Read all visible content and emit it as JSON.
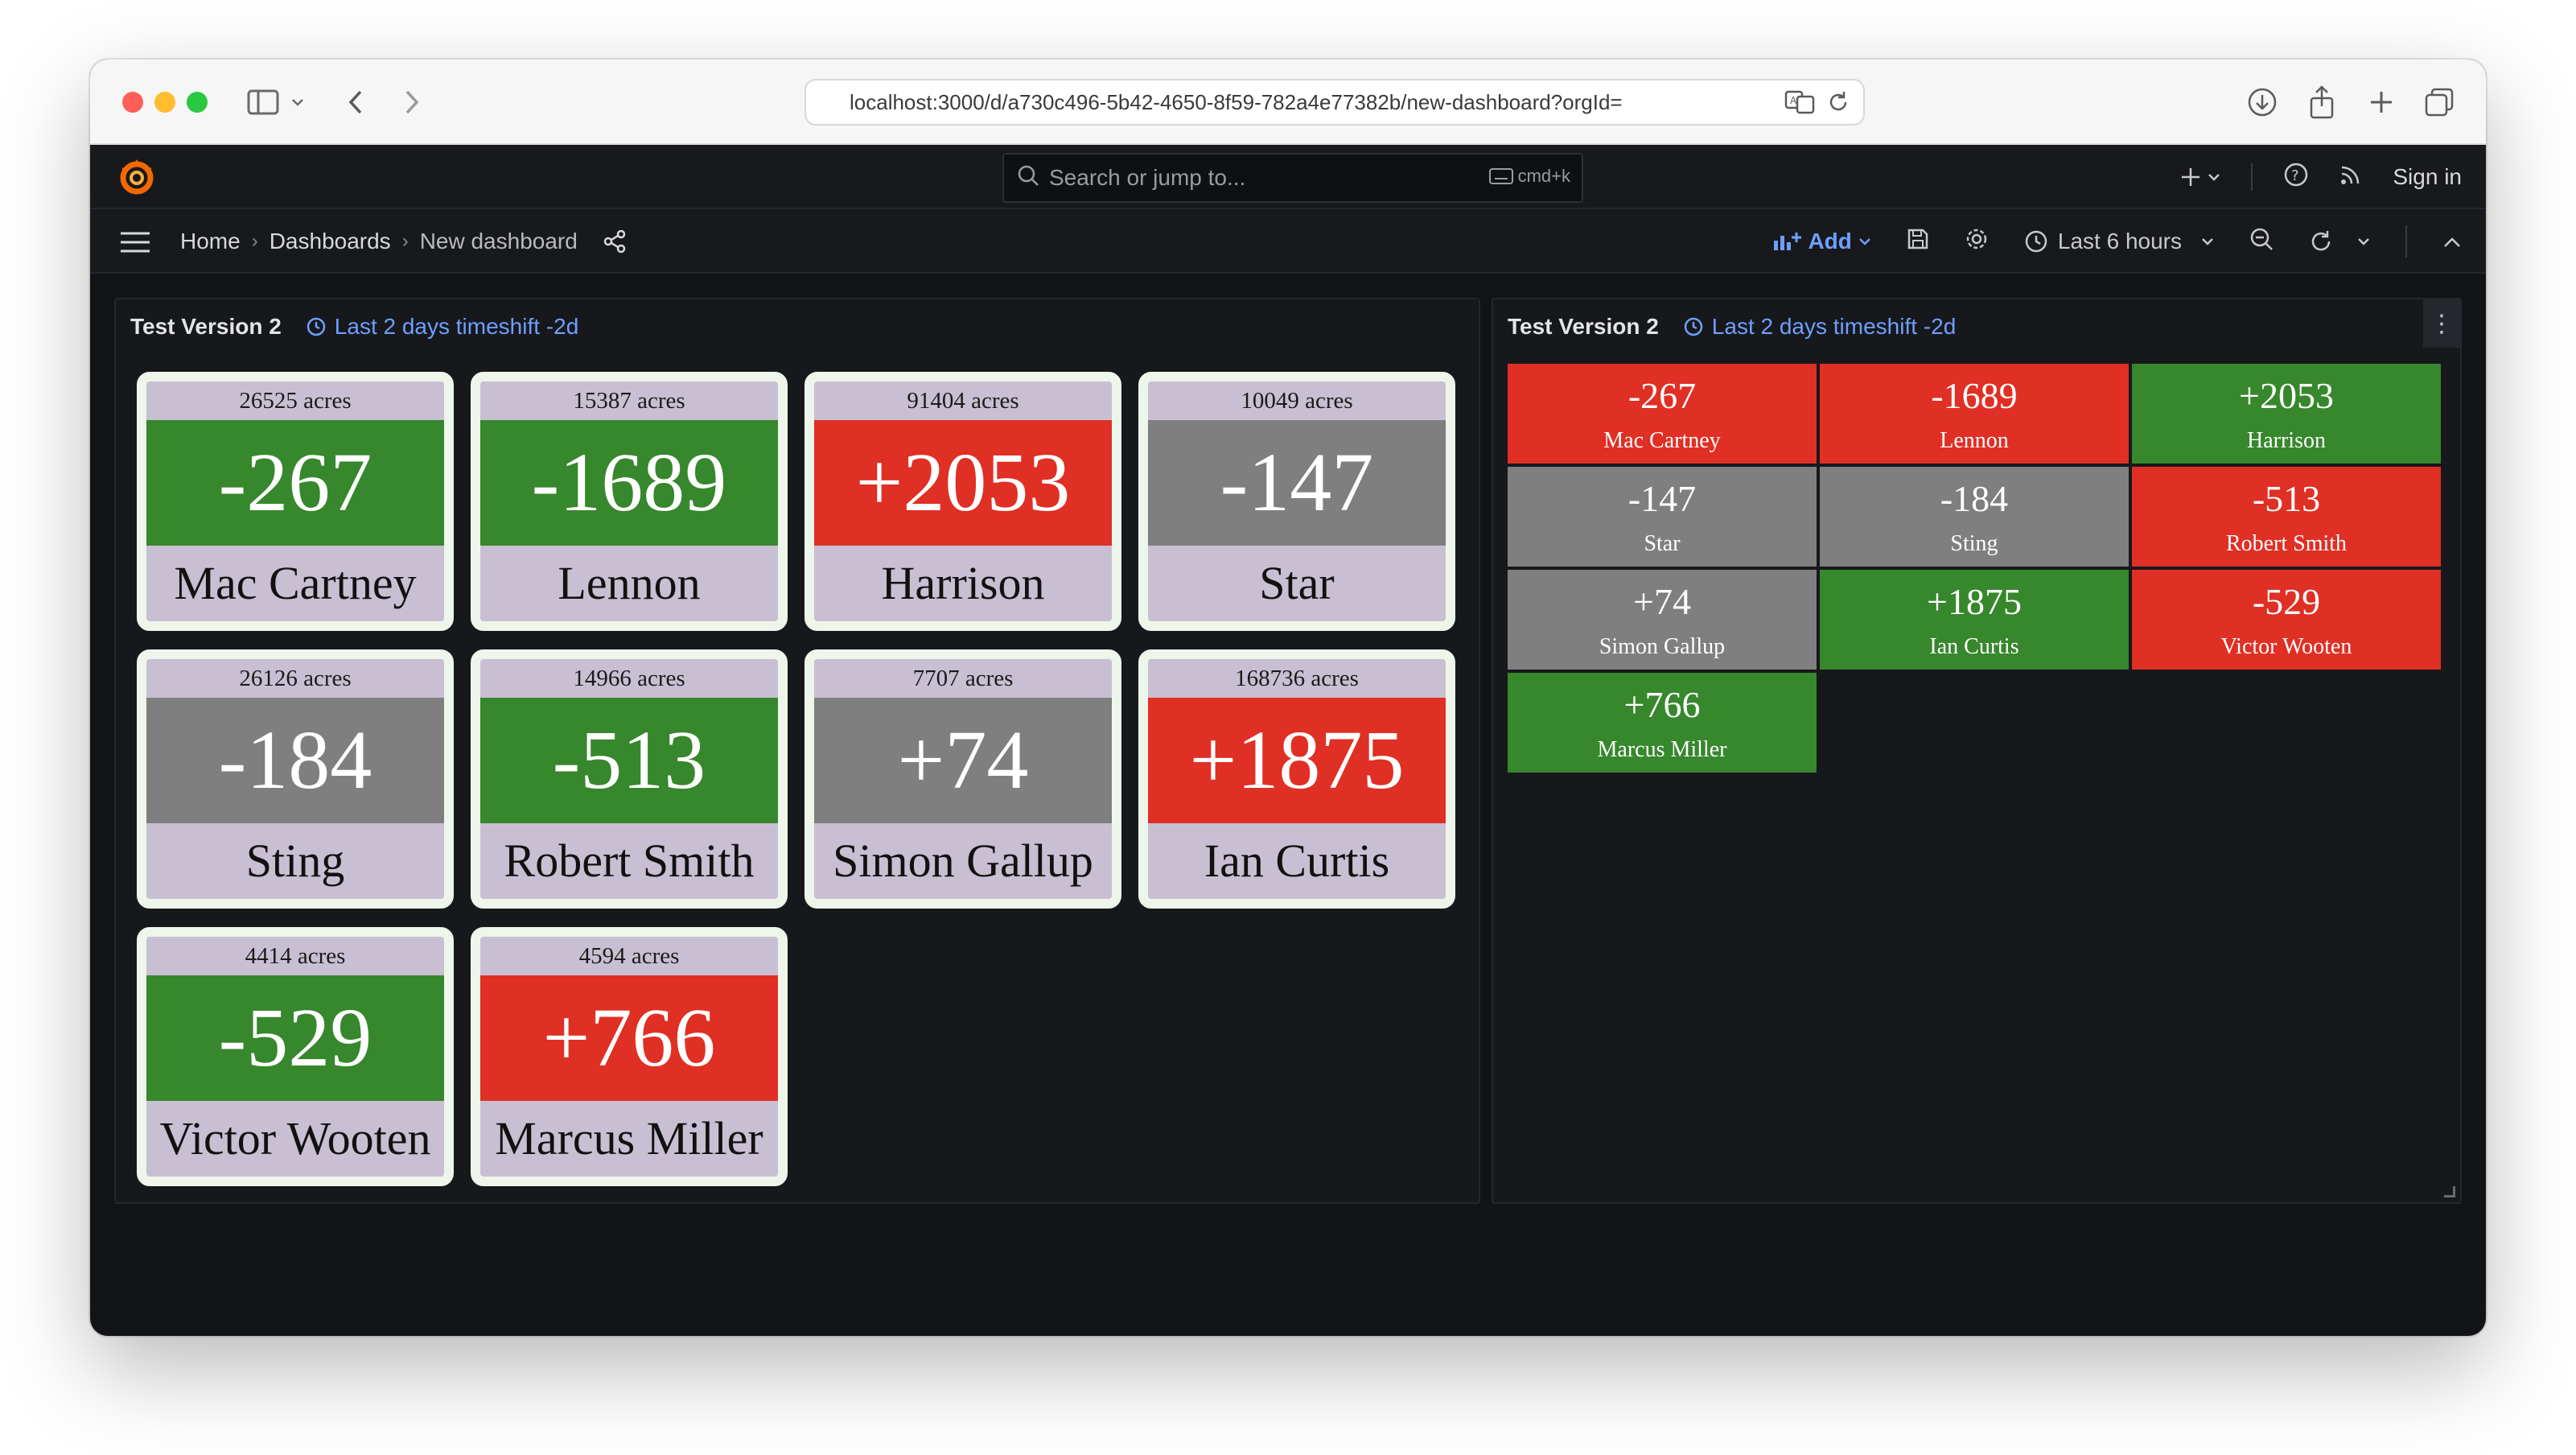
{
  "browser": {
    "url": "localhost:3000/d/a730c496-5b42-4650-8f59-782a4e77382b/new-dashboard?orgId="
  },
  "topbar": {
    "search_placeholder": "Search or jump to...",
    "search_shortcut": "cmd+k",
    "sign_in": "Sign in"
  },
  "breadcrumb": {
    "home": "Home",
    "dashboards": "Dashboards",
    "current": "New dashboard"
  },
  "toolbar": {
    "add_label": "Add",
    "time_range": "Last 6 hours"
  },
  "colors": {
    "green": "#37872d",
    "red": "#e02f24",
    "gray": "#7f7f7f",
    "card_bg": "#c9bfd3",
    "accent_blue": "#6e9fff"
  },
  "panel_left": {
    "title": "Test Version 2",
    "timeshift": "Last 2 days timeshift -2d",
    "cards": [
      {
        "acres": "26525 acres",
        "value": "-267",
        "name": "Mac Cartney",
        "status": "green"
      },
      {
        "acres": "15387 acres",
        "value": "-1689",
        "name": "Lennon",
        "status": "green"
      },
      {
        "acres": "91404 acres",
        "value": "+2053",
        "name": "Harrison",
        "status": "red"
      },
      {
        "acres": "10049 acres",
        "value": "-147",
        "name": "Star",
        "status": "gray"
      },
      {
        "acres": "26126 acres",
        "value": "-184",
        "name": "Sting",
        "status": "gray"
      },
      {
        "acres": "14966 acres",
        "value": "-513",
        "name": "Robert Smith",
        "status": "green"
      },
      {
        "acres": "7707 acres",
        "value": "+74",
        "name": "Simon Gallup",
        "status": "gray"
      },
      {
        "acres": "168736 acres",
        "value": "+1875",
        "name": "Ian Curtis",
        "status": "red"
      },
      {
        "acres": "4414 acres",
        "value": "-529",
        "name": "Victor Wooten",
        "status": "green"
      },
      {
        "acres": "4594 acres",
        "value": "+766",
        "name": "Marcus Miller",
        "status": "red"
      }
    ]
  },
  "panel_right": {
    "title": "Test Version 2",
    "timeshift": "Last 2 days timeshift -2d",
    "tiles": [
      {
        "value": "-267",
        "name": "Mac Cartney",
        "status": "red"
      },
      {
        "value": "-1689",
        "name": "Lennon",
        "status": "red"
      },
      {
        "value": "+2053",
        "name": "Harrison",
        "status": "green"
      },
      {
        "value": "-147",
        "name": "Star",
        "status": "gray"
      },
      {
        "value": "-184",
        "name": "Sting",
        "status": "gray"
      },
      {
        "value": "-513",
        "name": "Robert Smith",
        "status": "red"
      },
      {
        "value": "+74",
        "name": "Simon Gallup",
        "status": "gray"
      },
      {
        "value": "+1875",
        "name": "Ian Curtis",
        "status": "green"
      },
      {
        "value": "-529",
        "name": "Victor Wooten",
        "status": "red"
      },
      {
        "value": "+766",
        "name": "Marcus Miller",
        "status": "green"
      }
    ]
  }
}
